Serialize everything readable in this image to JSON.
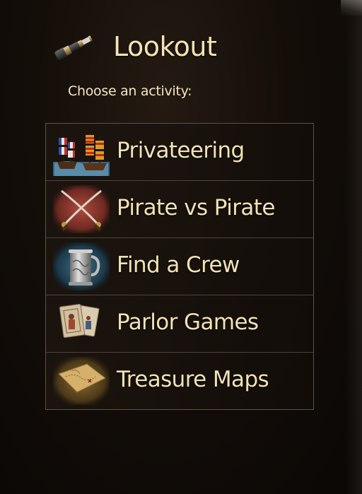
{
  "header": {
    "title": "Lookout",
    "subtitle": "Choose an activity:",
    "icon": "spyglass-icon"
  },
  "menu": {
    "items": [
      {
        "label": "Privateering",
        "icon": "ships-icon"
      },
      {
        "label": "Pirate vs Pirate",
        "icon": "crossed-swords-icon"
      },
      {
        "label": "Find a Crew",
        "icon": "tankard-icon"
      },
      {
        "label": "Parlor Games",
        "icon": "playing-cards-icon"
      },
      {
        "label": "Treasure Maps",
        "icon": "treasure-map-icon"
      }
    ]
  },
  "colors": {
    "background": "#140e09",
    "text": "#f1e2b6",
    "border": "#5d5145"
  }
}
